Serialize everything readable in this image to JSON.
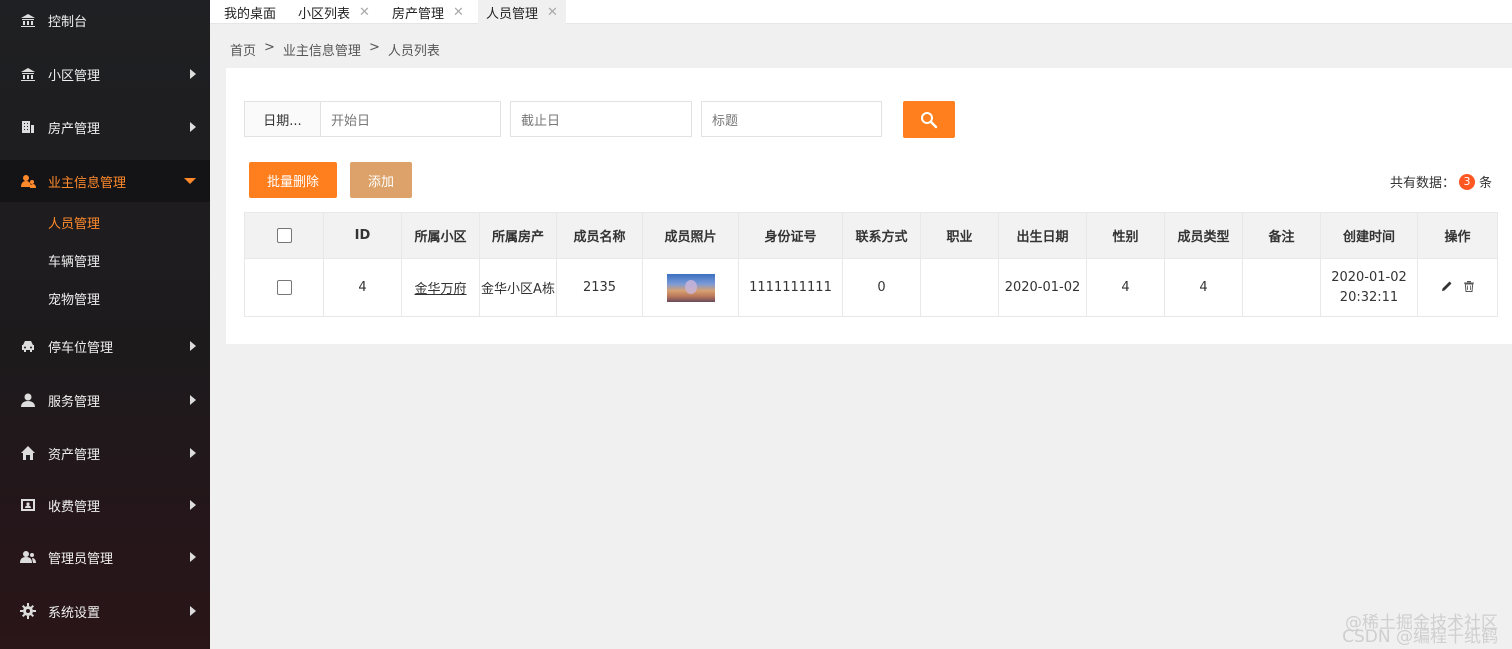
{
  "sidebar": {
    "items": [
      {
        "label": "控制台",
        "icon": "bank-icon"
      },
      {
        "label": "小区管理",
        "icon": "bank-icon"
      },
      {
        "label": "房产管理",
        "icon": "building-icon"
      },
      {
        "label": "业主信息管理",
        "icon": "user-group-icon"
      },
      {
        "label": "停车位管理",
        "icon": "car-icon"
      },
      {
        "label": "服务管理",
        "icon": "user-icon"
      },
      {
        "label": "资产管理",
        "icon": "home-icon"
      },
      {
        "label": "收费管理",
        "icon": "contact-card-icon"
      },
      {
        "label": "管理员管理",
        "icon": "users-icon"
      },
      {
        "label": "系统设置",
        "icon": "gear-icon"
      }
    ],
    "subitems": [
      {
        "label": "人员管理"
      },
      {
        "label": "车辆管理"
      },
      {
        "label": "宠物管理"
      }
    ]
  },
  "tabs": [
    {
      "label": "我的桌面"
    },
    {
      "label": "小区列表"
    },
    {
      "label": "房产管理"
    },
    {
      "label": "人员管理"
    }
  ],
  "breadcrumb": {
    "home": "首页",
    "sep": ">",
    "section": "业主信息管理",
    "page": "人员列表"
  },
  "search": {
    "date_label": "日期...",
    "start_placeholder": "开始日",
    "end_placeholder": "截止日",
    "title_placeholder": "标题"
  },
  "actions": {
    "batch_delete": "批量删除",
    "add": "添加"
  },
  "total": {
    "prefix": "共有数据：",
    "count": "3",
    "suffix": "条"
  },
  "table": {
    "headers": [
      "ID",
      "所属小区",
      "所属房产",
      "成员名称",
      "成员照片",
      "身份证号",
      "联系方式",
      "职业",
      "出生日期",
      "性别",
      "成员类型",
      "备注",
      "创建时间",
      "操作"
    ],
    "rows": [
      {
        "id": "4",
        "community": "金华万府",
        "property": "金华小区A栋",
        "name": "2135",
        "id_card": "1111111111",
        "contact": "0",
        "job": "",
        "birth": "2020-01-02",
        "gender": "4",
        "member_type": "4",
        "remark": "",
        "created": "2020-01-02 20:32:11"
      }
    ]
  },
  "watermark": {
    "line1": "@稀土掘金技术社区",
    "line2": "CSDN @编程千纸鹤"
  },
  "colors": {
    "accent": "#ff7f1e",
    "add_button": "#dca269",
    "badge": "#ff5722",
    "active_text": "#ff8a2b"
  }
}
